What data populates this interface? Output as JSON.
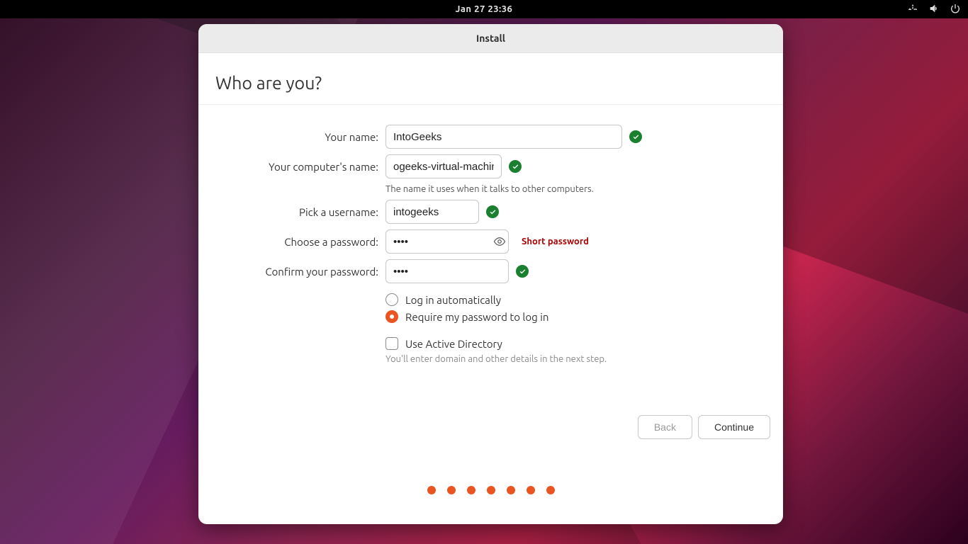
{
  "topbar": {
    "datetime": "Jan 27  23:36",
    "icons": {
      "network": "network-icon",
      "volume": "volume-icon",
      "power": "power-icon"
    }
  },
  "window": {
    "title": "Install",
    "heading": "Who are you?"
  },
  "form": {
    "name_label": "Your name:",
    "name_value": "IntoGeeks",
    "computer_label": "Your computer's name:",
    "computer_value": "ogeeks-virtual-machine",
    "computer_help": "The name it uses when it talks to other computers.",
    "username_label": "Pick a username:",
    "username_value": "intogeeks",
    "password_label": "Choose a password:",
    "password_value": "••••",
    "password_warn": "Short password",
    "confirm_label": "Confirm your password:",
    "confirm_value": "••••",
    "login_auto_label": "Log in automatically",
    "login_pw_label": "Require my password to log in",
    "ad_label": "Use Active Directory",
    "ad_help": "You'll enter domain and other details in the next step."
  },
  "buttons": {
    "back": "Back",
    "continue": "Continue"
  },
  "progress": {
    "total_dots": 7
  },
  "colors": {
    "accent": "#e95420",
    "success": "#1a7f2e",
    "error": "#aa0000"
  }
}
